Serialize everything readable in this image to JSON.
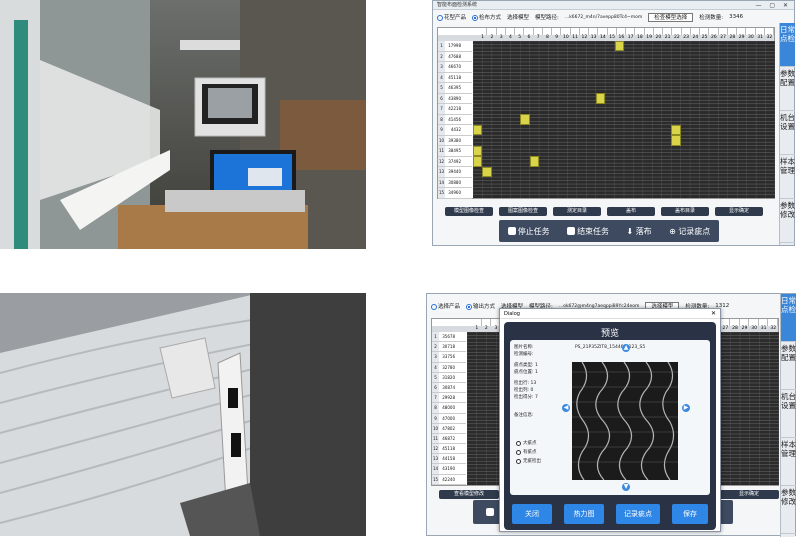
{
  "screen1": {
    "window_title": "智能布面检测系统",
    "top": {
      "option1": "花型产品",
      "option2": "检布方式",
      "option3": "选择模型",
      "model_label": "模型路径:",
      "model_path": "...k6672_m4n/7avepp80Tc4~mom",
      "select_btn": "检查模型选择",
      "count_label": "检测数量:",
      "count_value": "3346"
    },
    "row_numbers": [
      "1",
      "2",
      "3",
      "4",
      "5",
      "6",
      "7",
      "8",
      "9",
      "10",
      "11",
      "12",
      "13",
      "14",
      "15"
    ],
    "row_values": [
      "17998",
      "47688",
      "46670",
      "45118",
      "46395",
      "43890",
      "42218",
      "41456",
      "4432",
      "39380",
      "38495",
      "37492",
      "39440",
      "30880",
      "34960"
    ],
    "buttons": [
      "模型图像检查",
      "图案图像检查",
      "测定目录",
      "盖布",
      "盖布目录",
      "显示确定"
    ],
    "actions": [
      "停止任务",
      "结束任务",
      "落布",
      "记录疵点"
    ],
    "sidebar": [
      "日常点检",
      "参数配置",
      "机台设置",
      "样本管理",
      "参数修改"
    ]
  },
  "screen2": {
    "top": {
      "option1": "选择产品",
      "option2": "输出方式",
      "option3": "选择模型",
      "model_label": "模型路径:",
      "model_path": "...ok672@m4ng7aeqppi89Yc24eom",
      "select_btn": "选择模型",
      "count_label": "检测数量:",
      "count_value": "1312"
    },
    "row_numbers": [
      "1",
      "2",
      "3",
      "4",
      "5",
      "6",
      "7",
      "8",
      "9",
      "10",
      "11",
      "12",
      "13",
      "14",
      "15"
    ],
    "row_values": [
      "35678",
      "30718",
      "33756",
      "32780",
      "31820",
      "30874",
      "29928",
      "48000",
      "47000",
      "47802",
      "46872",
      "45118",
      "44158",
      "43190",
      "42240"
    ],
    "buttons": [
      "查看模型修改",
      "显示确定"
    ],
    "dialog": {
      "title": "Dialog",
      "heading": "预览",
      "image_name_label": "图片名称:",
      "image_name": "PS_21P35ZIT8_154466_123_S5",
      "source_label": "检测编号:",
      "defect_type_label": "疵点类型:",
      "defect_type": "1",
      "position_label": "疵点位置:",
      "position": "1",
      "row_label": "检出行:",
      "row": "13",
      "col_label": "检出列:",
      "col": "0",
      "score_label": "检出得分:",
      "score": "7",
      "notes_label": "备注信息:",
      "options": [
        "大疵点",
        "有疵点",
        "无疵检出"
      ],
      "buttons": [
        "关闭",
        "热力图",
        "记录疵点",
        "保存"
      ]
    },
    "sidebar": [
      "日常点检",
      "参数配置",
      "机台设置",
      "样本管理",
      "参数修改"
    ]
  },
  "colors": {
    "accent": "#2e86e6",
    "dark_panel": "#2a3346",
    "defect": "#d9d44a"
  }
}
